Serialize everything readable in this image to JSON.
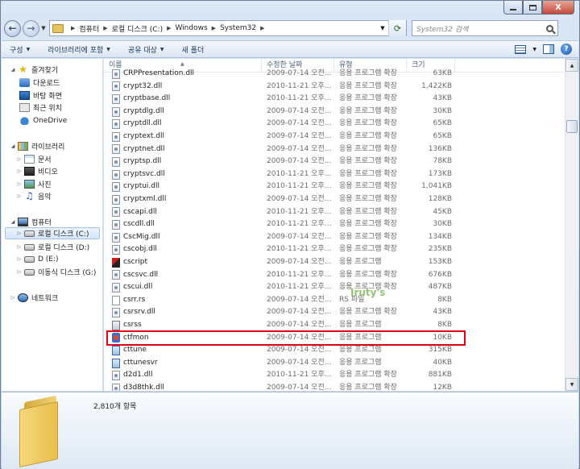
{
  "window": {
    "close_label": "X"
  },
  "address": {
    "crumbs": [
      "컴퓨터",
      "로컬 디스크 (C:)",
      "Windows",
      "System32"
    ],
    "search_placeholder": "System32 검색"
  },
  "toolbar": {
    "organize": "구성",
    "include_library": "라이브러리에 포함",
    "share": "공유 대상",
    "new_folder": "새 폴더"
  },
  "nav": {
    "favorites": "즐겨찾기",
    "downloads": "다운로드",
    "desktop": "바탕 화면",
    "recent": "최근 위치",
    "onedrive": "OneDrive",
    "libraries": "라이브러리",
    "documents": "문서",
    "videos": "비디오",
    "pictures": "사진",
    "music": "음악",
    "computer": "컴퓨터",
    "drive_c": "로컬 디스크 (C:)",
    "drive_d": "로컬 디스크 (D:)",
    "drive_e": "D (E:)",
    "drive_g": "이동식 디스크 (G:)",
    "network": "네트워크"
  },
  "columns": {
    "name": "이름",
    "date": "수정한 날짜",
    "type": "유형",
    "size": "크기"
  },
  "files": [
    {
      "name": "CRPPresentation.dll",
      "date": "2009-07-14 오전...",
      "type": "응용 프로그램 확장",
      "size": "63KB",
      "icon": "dll"
    },
    {
      "name": "crypt32.dll",
      "date": "2010-11-21 오후...",
      "type": "응용 프로그램 확장",
      "size": "1,422KB",
      "icon": "dll"
    },
    {
      "name": "cryptbase.dll",
      "date": "2010-11-21 오후...",
      "type": "응용 프로그램 확장",
      "size": "43KB",
      "icon": "dll"
    },
    {
      "name": "cryptdlg.dll",
      "date": "2009-07-14 오전...",
      "type": "응용 프로그램 확장",
      "size": "30KB",
      "icon": "dll"
    },
    {
      "name": "cryptdll.dll",
      "date": "2009-07-14 오전...",
      "type": "응용 프로그램 확장",
      "size": "65KB",
      "icon": "dll"
    },
    {
      "name": "cryptext.dll",
      "date": "2009-07-14 오전...",
      "type": "응용 프로그램 확장",
      "size": "65KB",
      "icon": "dll"
    },
    {
      "name": "cryptnet.dll",
      "date": "2009-07-14 오전...",
      "type": "응용 프로그램 확장",
      "size": "136KB",
      "icon": "dll"
    },
    {
      "name": "cryptsp.dll",
      "date": "2009-07-14 오전...",
      "type": "응용 프로그램 확장",
      "size": "78KB",
      "icon": "dll"
    },
    {
      "name": "cryptsvc.dll",
      "date": "2010-11-21 오후...",
      "type": "응용 프로그램 확장",
      "size": "173KB",
      "icon": "dll"
    },
    {
      "name": "cryptui.dll",
      "date": "2010-11-21 오후...",
      "type": "응용 프로그램 확장",
      "size": "1,041KB",
      "icon": "dll"
    },
    {
      "name": "cryptxml.dll",
      "date": "2009-07-14 오전...",
      "type": "응용 프로그램 확장",
      "size": "128KB",
      "icon": "dll"
    },
    {
      "name": "cscapi.dll",
      "date": "2010-11-21 오후...",
      "type": "응용 프로그램 확장",
      "size": "45KB",
      "icon": "dll"
    },
    {
      "name": "cscdll.dll",
      "date": "2010-11-21 오후...",
      "type": "응용 프로그램 확장",
      "size": "30KB",
      "icon": "dll"
    },
    {
      "name": "CscMig.dll",
      "date": "2009-07-14 오전...",
      "type": "응용 프로그램 확장",
      "size": "134KB",
      "icon": "dll"
    },
    {
      "name": "cscobj.dll",
      "date": "2010-11-21 오후...",
      "type": "응용 프로그램 확장",
      "size": "235KB",
      "icon": "dll"
    },
    {
      "name": "cscript",
      "date": "2009-07-14 오전...",
      "type": "응용 프로그램",
      "size": "153KB",
      "icon": "script"
    },
    {
      "name": "cscsvc.dll",
      "date": "2010-11-21 오후...",
      "type": "응용 프로그램 확장",
      "size": "676KB",
      "icon": "dll"
    },
    {
      "name": "cscui.dll",
      "date": "2010-11-21 오후...",
      "type": "응용 프로그램 확장",
      "size": "487KB",
      "icon": "dll"
    },
    {
      "name": "csrr.rs",
      "date": "2009-07-14 오전...",
      "type": "RS 파일",
      "size": "8KB",
      "icon": "rs"
    },
    {
      "name": "csrsrv.dll",
      "date": "2009-07-14 오전...",
      "type": "응용 프로그램 확장",
      "size": "43KB",
      "icon": "dll"
    },
    {
      "name": "csrss",
      "date": "2009-07-14 오전...",
      "type": "응용 프로그램",
      "size": "8KB",
      "icon": "sys"
    },
    {
      "name": "ctfmon",
      "date": "2009-07-14 오전...",
      "type": "응용 프로그램",
      "size": "10KB",
      "icon": "ctf"
    },
    {
      "name": "cttune",
      "date": "2009-07-14 오전...",
      "type": "응용 프로그램",
      "size": "315KB",
      "icon": "exe"
    },
    {
      "name": "cttunesvr",
      "date": "2009-07-14 오전...",
      "type": "응용 프로그램",
      "size": "40KB",
      "icon": "exe"
    },
    {
      "name": "d2d1.dll",
      "date": "2010-11-21 오후...",
      "type": "응용 프로그램 확장",
      "size": "881KB",
      "icon": "dll"
    },
    {
      "name": "d3d8thk.dll",
      "date": "2009-07-14 오전...",
      "type": "응용 프로그램 확장",
      "size": "12KB",
      "icon": "dll"
    }
  ],
  "highlighted_file": "ctfmon",
  "details": {
    "item_count": "2,810개 항목"
  },
  "watermark": "Iruty's",
  "colors": {
    "highlight": "#e0001a",
    "selection": "#d5e6fa"
  }
}
